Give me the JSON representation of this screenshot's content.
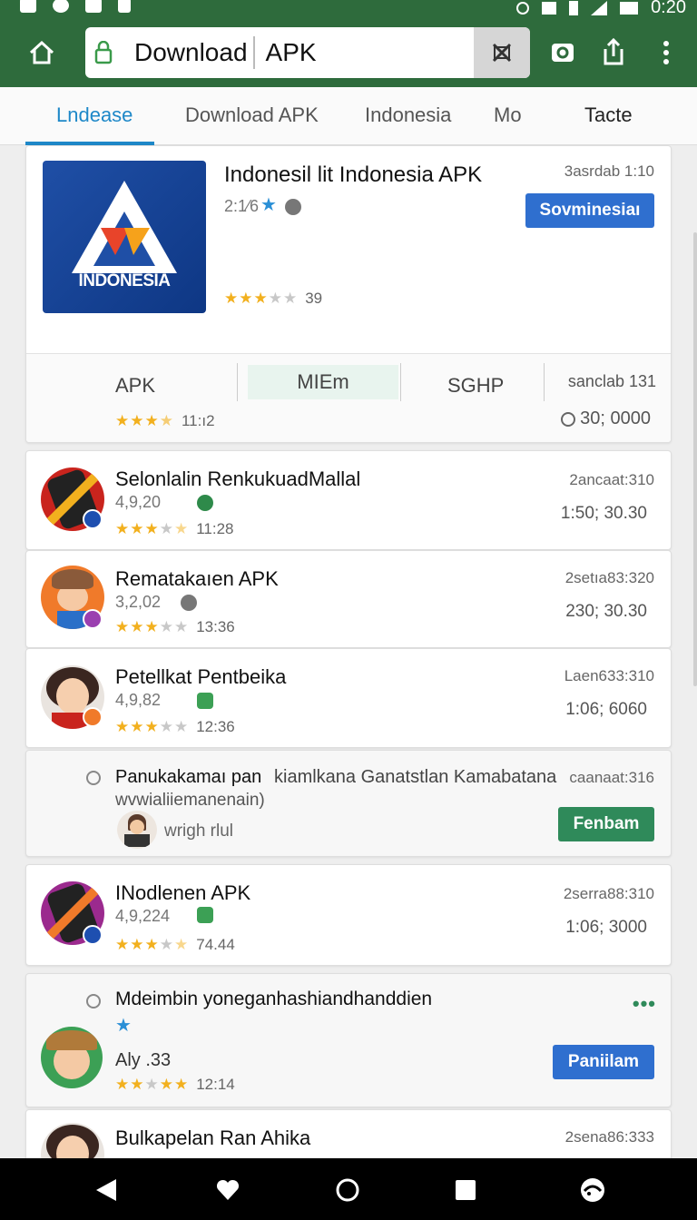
{
  "status_bar": {
    "time": "0:20"
  },
  "toolbar": {
    "url_primary": "Download",
    "url_secondary": "APK"
  },
  "tabs": [
    {
      "label": "Lndease",
      "active": true
    },
    {
      "label": "Download APK"
    },
    {
      "label": "Indonesia"
    },
    {
      "label": "Mo"
    },
    {
      "label": "Tacte"
    }
  ],
  "featured": {
    "logo_text": "INDONESIA",
    "title": "Indonesil lit Indonesia APK",
    "meta": "2:1⁄6",
    "date": "3asrdab 1:10",
    "button": "Sovminesiaı",
    "stars_full": 3,
    "stars_total": 5,
    "rating_label": "39",
    "sub_tabs": [
      "APK",
      "MIEm",
      "SGHP"
    ],
    "sub_right": "sanclab 131",
    "sub_rating_label": "11:ı2",
    "sub_count": "30; 0000"
  },
  "apps": [
    {
      "title": "Selonlalin RenkukuadMallal",
      "meta": "4,9,20",
      "stars_label": "11:28",
      "date": "2ancaat:310",
      "size": "1:50; 30.30"
    },
    {
      "title": "Rematakaıen APK",
      "meta": "3,2,02",
      "stars_label": "13:36",
      "date": "2setıa83:320",
      "size": "230; 30.30"
    },
    {
      "title": "Petellkat Pentbeika",
      "meta": "4,9,82",
      "stars_label": "12:36",
      "date": "Laen633:310",
      "size": "1:06; 6060"
    },
    {
      "title": "INodlenen APK",
      "meta": "4,9,224",
      "stars_label": "74.44",
      "date": "2serra88:310",
      "size": "1:06; 3000"
    }
  ],
  "promo": {
    "title": "Panukakamaı pan",
    "title_rest": "kiamlkana Ganatstlan Kamabatana",
    "subtitle": "wvwialiiemanenain)",
    "user": "wrigh rlul",
    "date": "caanaat:316",
    "button": "Fenbam"
  },
  "promo2": {
    "title": "Mdeimbin yoneganhashiandhanddien",
    "meta": "Aly .33",
    "stars_label": "12:14",
    "button": "Paniilam"
  },
  "partial": {
    "title": "Bulkapelan Ran Ahika",
    "date": "2sena86:333"
  },
  "colors": {
    "toolbar": "#2e6b3c",
    "accent": "#1e88c8",
    "primary_button": "#2f6fcf",
    "green_button": "#2f8a5a",
    "star": "#f2b01e"
  }
}
